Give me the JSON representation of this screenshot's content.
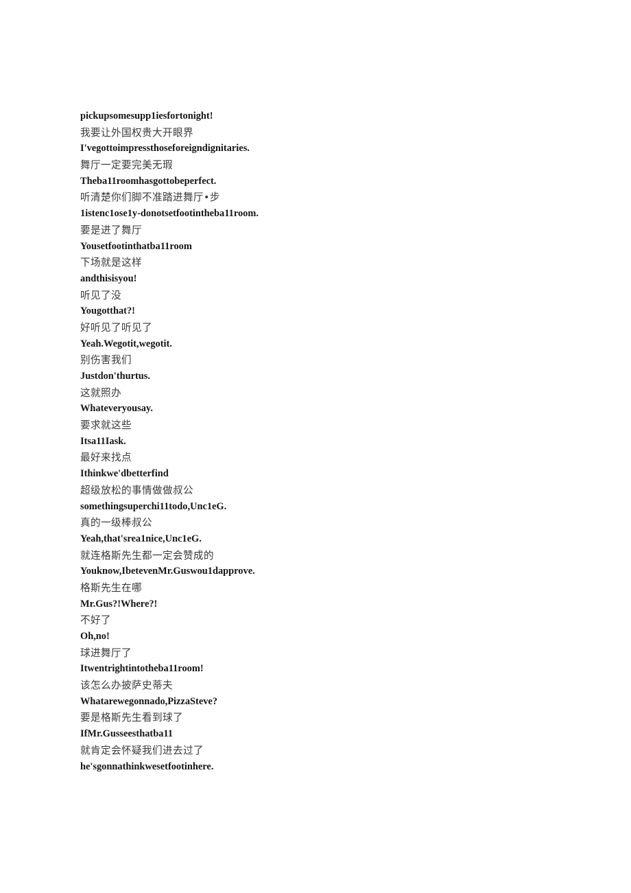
{
  "document": {
    "background_color": "#ffffff",
    "text_color_english": "#161616",
    "text_color_chinese": "#3a3a3a",
    "lines": [
      {
        "lang": "en",
        "text": "pickupsomesupp1iesfortonight!"
      },
      {
        "lang": "zh",
        "text": "我要让外国权贵大开眼界"
      },
      {
        "lang": "en",
        "text": "I'vegottoimpressthoseforeigndignitaries."
      },
      {
        "lang": "zh",
        "text": "舞厅一定要完美无瑕"
      },
      {
        "lang": "en",
        "text": "Theba11roomhasgottobeperfect."
      },
      {
        "lang": "zh",
        "text": "听清楚你们脚不准踏进舞厅•步"
      },
      {
        "lang": "en",
        "text": "1istenc1ose1y-donotsetfootintheba11room."
      },
      {
        "lang": "zh",
        "text": "要是进了舞厅"
      },
      {
        "lang": "en",
        "text": "Yousetfootinthatba11room"
      },
      {
        "lang": "zh",
        "text": "下场就是这样"
      },
      {
        "lang": "en",
        "text": "andthisisyou!"
      },
      {
        "lang": "zh",
        "text": "听见了没"
      },
      {
        "lang": "en",
        "text": "Yougotthat?!"
      },
      {
        "lang": "zh",
        "text": "好听见了听见了"
      },
      {
        "lang": "en",
        "text": "Yeah.Wegotit,wegotit."
      },
      {
        "lang": "zh",
        "text": "别伤害我们"
      },
      {
        "lang": "en",
        "text": "Justdon'thurtus."
      },
      {
        "lang": "zh",
        "text": "这就照办"
      },
      {
        "lang": "en",
        "text": "Whateveryousay."
      },
      {
        "lang": "zh",
        "text": "要求就这些"
      },
      {
        "lang": "en",
        "text": "Itsa11Iask."
      },
      {
        "lang": "zh",
        "text": "最好来找点"
      },
      {
        "lang": "en",
        "text": "Ithinkwe'dbetterfind"
      },
      {
        "lang": "zh",
        "text": "超级放松的事情做做叔公"
      },
      {
        "lang": "en",
        "text": "somethingsuperchi11todo,Unc1eG."
      },
      {
        "lang": "zh",
        "text": "真的一级棒叔公"
      },
      {
        "lang": "en",
        "text": "Yeah,that'srea1nice,Unc1eG."
      },
      {
        "lang": "zh",
        "text": "就连格斯先生都一定会赞成的"
      },
      {
        "lang": "en",
        "text": "Youknow,IbetevenMr.Guswou1dapprove."
      },
      {
        "lang": "zh",
        "text": "格斯先生在哪"
      },
      {
        "lang": "en",
        "text": "Mr.Gus?!Where?!"
      },
      {
        "lang": "zh",
        "text": "不好了"
      },
      {
        "lang": "en",
        "text": "Oh,no!"
      },
      {
        "lang": "zh",
        "text": "球进舞厅了"
      },
      {
        "lang": "en",
        "text": "Itwentrightintotheba11room!"
      },
      {
        "lang": "zh",
        "text": "该怎么办披萨史蒂夫"
      },
      {
        "lang": "en",
        "text": "Whatarewegonnado,PizzaSteve?"
      },
      {
        "lang": "zh",
        "text": "要是格斯先生看到球了"
      },
      {
        "lang": "en",
        "text": "IfMr.Gusseesthatba11"
      },
      {
        "lang": "zh",
        "text": "就肯定会怀疑我们进去过了"
      },
      {
        "lang": "en",
        "text": "he'sgonnathinkwesetfootinhere."
      }
    ]
  }
}
